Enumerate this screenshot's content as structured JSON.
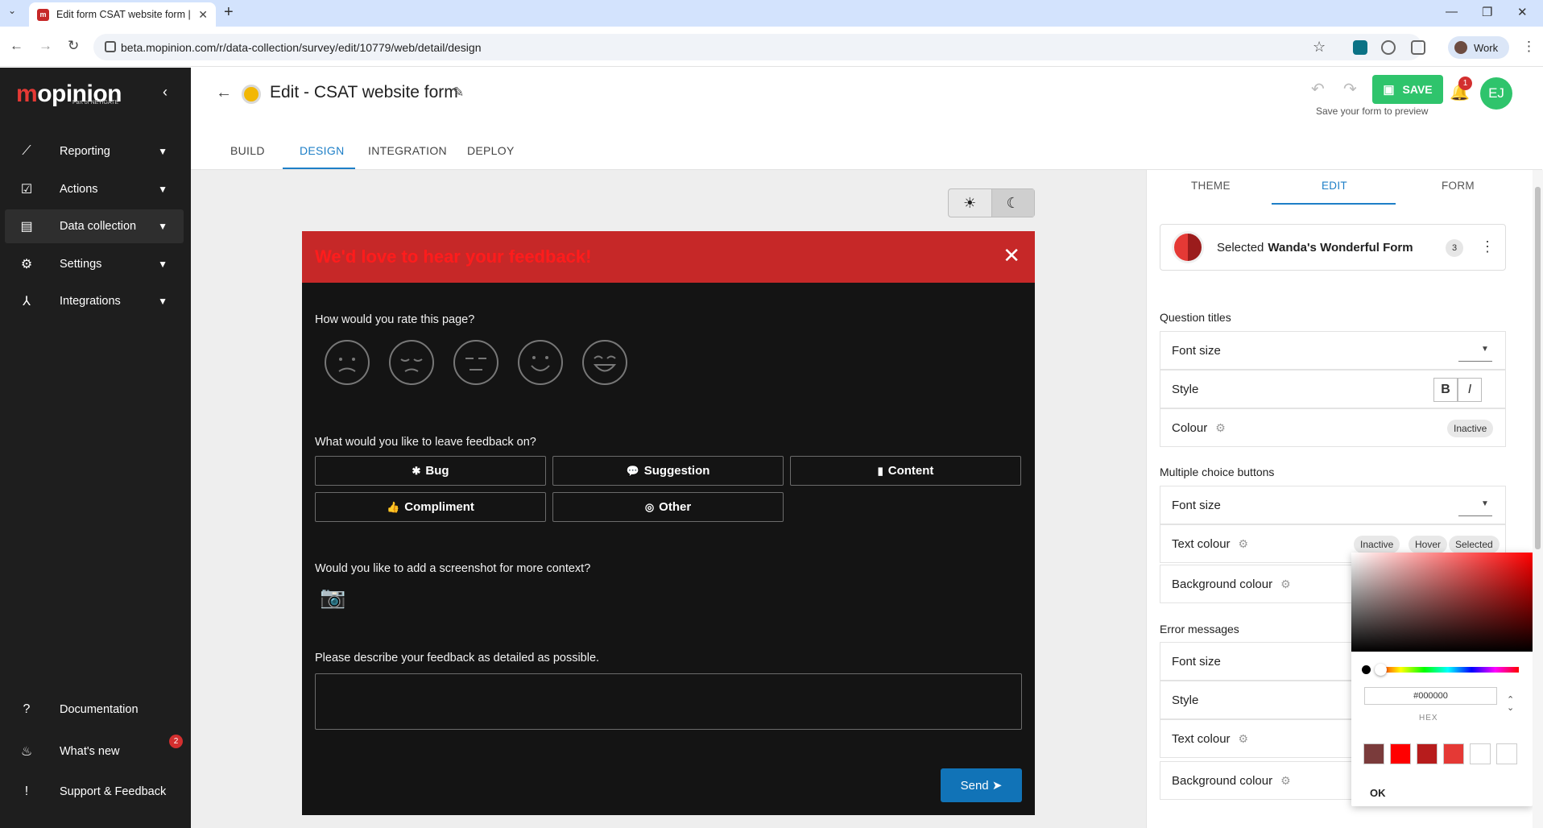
{
  "browser": {
    "tab_title": "Edit form CSAT website form | M",
    "url": "beta.mopinion.com/r/data-collection/survey/edit/10779/web/detail/design",
    "profile_label": "Work"
  },
  "sidebar": {
    "logo": "opinion",
    "logo_m": "m",
    "logo_sub": "Part of NETIGATE",
    "items": [
      {
        "label": "Reporting",
        "icon": "trend-icon"
      },
      {
        "label": "Actions",
        "icon": "check-clipboard-icon"
      },
      {
        "label": "Data collection",
        "icon": "clipboard-icon"
      },
      {
        "label": "Settings",
        "icon": "gear-icon"
      },
      {
        "label": "Integrations",
        "icon": "merge-icon"
      }
    ],
    "bottom": [
      {
        "label": "Documentation",
        "icon": "help-icon"
      },
      {
        "label": "What's new",
        "icon": "flame-icon",
        "badge": "2"
      },
      {
        "label": "Support & Feedback",
        "icon": "feedback-icon"
      }
    ]
  },
  "header": {
    "title": "Edit - CSAT website form",
    "save_label": "SAVE",
    "save_hint": "Save your form to preview",
    "notification_count": "1",
    "avatar_initials": "EJ",
    "tabs": [
      "BUILD",
      "DESIGN",
      "INTEGRATION",
      "DEPLOY"
    ]
  },
  "form": {
    "title": "We'd love to hear your feedback!",
    "q1": "How would you rate this page?",
    "q2": "What would you like to leave feedback on?",
    "options": [
      "Bug",
      "Suggestion",
      "Content",
      "Compliment",
      "Other"
    ],
    "q3": "Would you like to add a screenshot for more context?",
    "q4": "Please describe your feedback as detailed as possible.",
    "send_label": "Send"
  },
  "panel": {
    "tabs": [
      "THEME",
      "EDIT",
      "FORM"
    ],
    "selected_prefix": "Selected",
    "selected_name": "Wanda's Wonderful Form",
    "selected_count": "3",
    "sections": {
      "question_titles": "Question titles",
      "multiple_choice": "Multiple choice buttons",
      "error_messages": "Error messages"
    },
    "labels": {
      "font_size": "Font size",
      "style": "Style",
      "colour": "Colour",
      "text_colour": "Text colour",
      "background_colour": "Background colour"
    },
    "chips": {
      "inactive": "Inactive",
      "hover": "Hover",
      "selected": "Selected"
    }
  },
  "picker": {
    "hex_value": "#000000",
    "hex_label": "HEX",
    "ok_label": "OK",
    "swatches": [
      "#7a3b3b",
      "#ff0000",
      "#b71c1c",
      "#e53935",
      "#ffffff",
      "#ffffff"
    ]
  }
}
